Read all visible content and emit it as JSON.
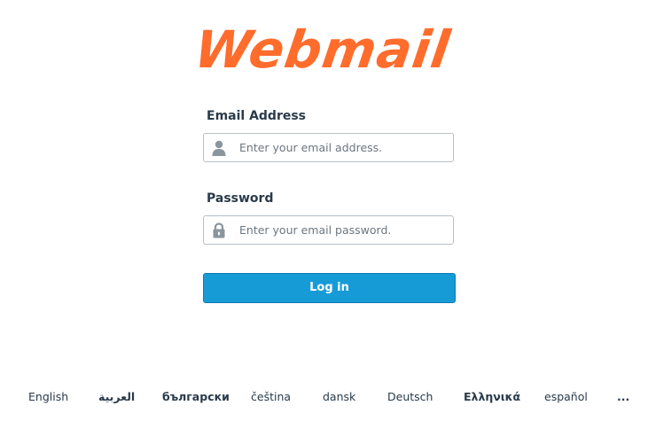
{
  "logo": {
    "text": "Webmail",
    "color": "#ff6c2c"
  },
  "form": {
    "email_label": "Email Address",
    "email_placeholder": "Enter your email address.",
    "email_icon": "user-icon",
    "password_label": "Password",
    "password_placeholder": "Enter your email password.",
    "password_icon": "lock-icon",
    "login_label": "Log in",
    "login_color": "#179bd7"
  },
  "languages": {
    "items": [
      "English",
      "العربية",
      "български",
      "čeština",
      "dansk",
      "Deutsch",
      "Ελληνικά",
      "español"
    ],
    "more": "..."
  }
}
